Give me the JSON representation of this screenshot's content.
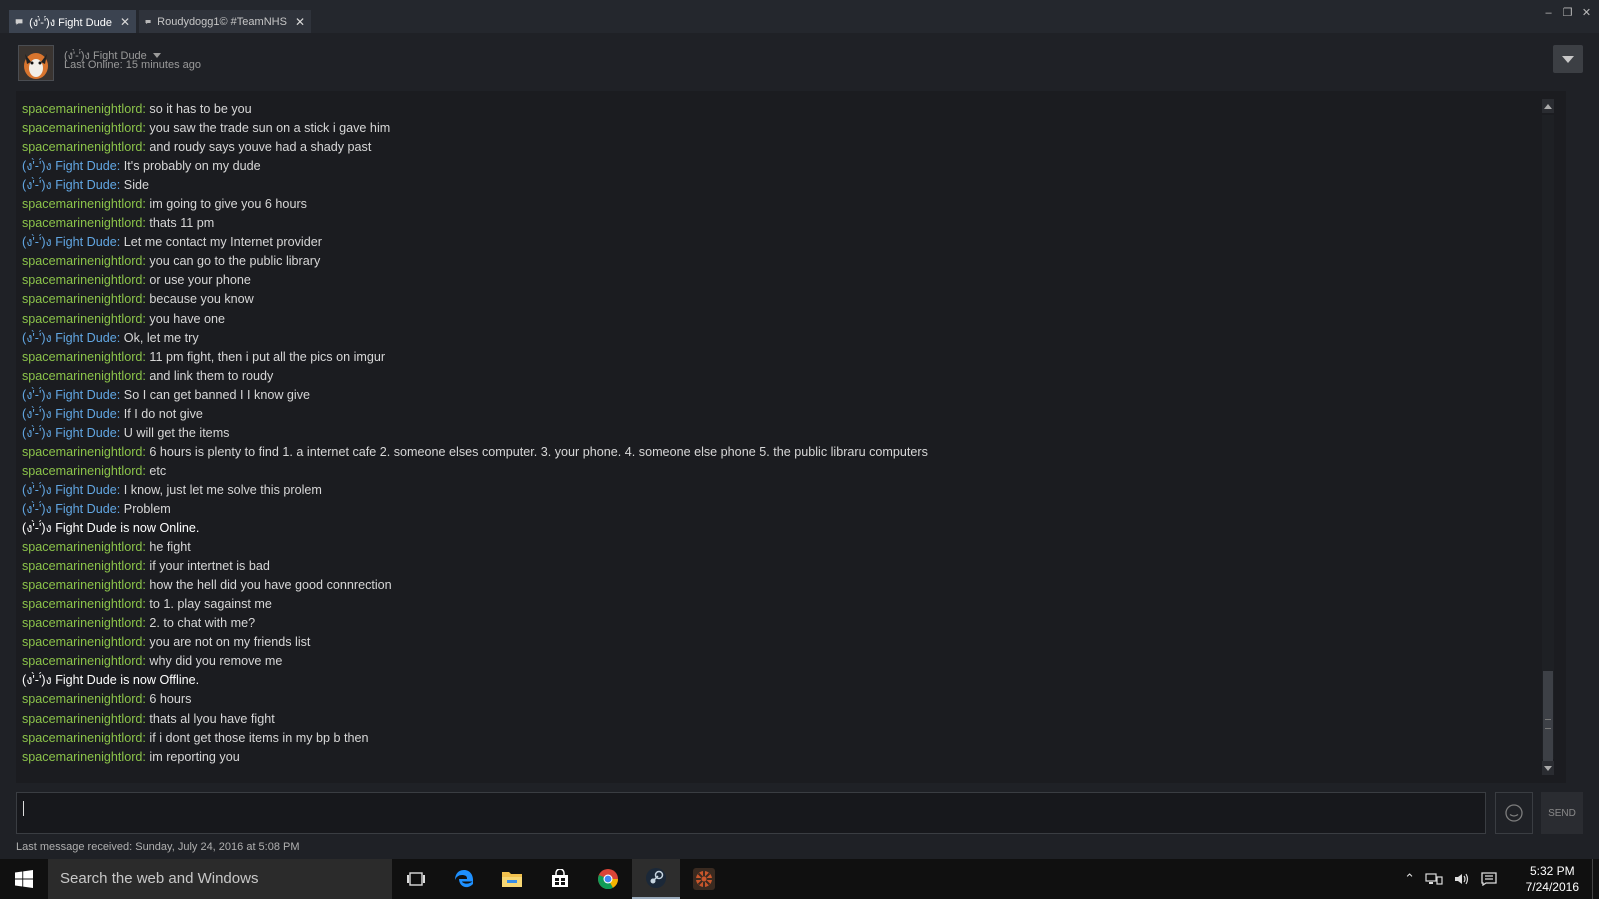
{
  "tabs": [
    {
      "label": "(ง'̀-'́)ง Fight Dude",
      "active": true
    },
    {
      "label": "Roudydogg1© #TeamNHS",
      "active": false
    }
  ],
  "window_controls": {
    "minimize": "–",
    "restore": "❐",
    "close": "✕"
  },
  "header": {
    "friend_name": "(ง'̀-'́)ง Fight Dude",
    "status": "Last Online: 15 minutes ago"
  },
  "colors": {
    "self_name": "#8bc34a",
    "friend_name": "#62a7e3",
    "message_text": "#d7d7d7",
    "background": "#1f2126"
  },
  "messages": [
    {
      "kind": "chat",
      "sender": "spacemarinenightlord",
      "side": "self",
      "text": "so it has to be you"
    },
    {
      "kind": "chat",
      "sender": "spacemarinenightlord",
      "side": "self",
      "text": "you saw the trade sun on a stick i gave him"
    },
    {
      "kind": "chat",
      "sender": "spacemarinenightlord",
      "side": "self",
      "text": "and roudy says youve had a shady past"
    },
    {
      "kind": "chat",
      "sender": "(ง'̀-'́)ง Fight Dude",
      "side": "friend",
      "text": "It's probably on my dude"
    },
    {
      "kind": "chat",
      "sender": "(ง'̀-'́)ง Fight Dude",
      "side": "friend",
      "text": "Side"
    },
    {
      "kind": "chat",
      "sender": "spacemarinenightlord",
      "side": "self",
      "text": "im going to give you 6 hours"
    },
    {
      "kind": "chat",
      "sender": "spacemarinenightlord",
      "side": "self",
      "text": "thats 11 pm"
    },
    {
      "kind": "chat",
      "sender": "(ง'̀-'́)ง Fight Dude",
      "side": "friend",
      "text": "Let me contact my Internet provider"
    },
    {
      "kind": "chat",
      "sender": "spacemarinenightlord",
      "side": "self",
      "text": "you can go to the public library"
    },
    {
      "kind": "chat",
      "sender": "spacemarinenightlord",
      "side": "self",
      "text": "or use your phone"
    },
    {
      "kind": "chat",
      "sender": "spacemarinenightlord",
      "side": "self",
      "text": "because you know"
    },
    {
      "kind": "chat",
      "sender": "spacemarinenightlord",
      "side": "self",
      "text": "you have one"
    },
    {
      "kind": "chat",
      "sender": "(ง'̀-'́)ง Fight Dude",
      "side": "friend",
      "text": "Ok, let me try"
    },
    {
      "kind": "chat",
      "sender": "spacemarinenightlord",
      "side": "self",
      "text": "11 pm fight, then i put all the pics on imgur"
    },
    {
      "kind": "chat",
      "sender": "spacemarinenightlord",
      "side": "self",
      "text": "and link them to roudy"
    },
    {
      "kind": "chat",
      "sender": "(ง'̀-'́)ง Fight Dude",
      "side": "friend",
      "text": "So I can get banned I I know give"
    },
    {
      "kind": "chat",
      "sender": "(ง'̀-'́)ง Fight Dude",
      "side": "friend",
      "text": "If I do not give"
    },
    {
      "kind": "chat",
      "sender": "(ง'̀-'́)ง Fight Dude",
      "side": "friend",
      "text": "U will get the items"
    },
    {
      "kind": "chat",
      "sender": "spacemarinenightlord",
      "side": "self",
      "text": "6 hours is plenty to find 1. a internet cafe 2. someone elses computer. 3. your phone. 4. someone else phone 5. the public libraru computers"
    },
    {
      "kind": "chat",
      "sender": "spacemarinenightlord",
      "side": "self",
      "text": "etc"
    },
    {
      "kind": "chat",
      "sender": "(ง'̀-'́)ง Fight Dude",
      "side": "friend",
      "text": "I know, just let me solve this prolem"
    },
    {
      "kind": "chat",
      "sender": "(ง'̀-'́)ง Fight Dude",
      "side": "friend",
      "text": "Problem"
    },
    {
      "kind": "status",
      "text": "(ง'̀-'́)ง Fight Dude is now Online."
    },
    {
      "kind": "chat",
      "sender": "spacemarinenightlord",
      "side": "self",
      "text": "he fight"
    },
    {
      "kind": "chat",
      "sender": "spacemarinenightlord",
      "side": "self",
      "text": "if your intertnet is bad"
    },
    {
      "kind": "chat",
      "sender": "spacemarinenightlord",
      "side": "self",
      "text": "how the hell did you have good connrection"
    },
    {
      "kind": "chat",
      "sender": "spacemarinenightlord",
      "side": "self",
      "text": "to 1. play sagainst me"
    },
    {
      "kind": "chat",
      "sender": "spacemarinenightlord",
      "side": "self",
      "text": "2. to chat with me?"
    },
    {
      "kind": "chat",
      "sender": "spacemarinenightlord",
      "side": "self",
      "text": "you are not on my friends list"
    },
    {
      "kind": "chat",
      "sender": "spacemarinenightlord",
      "side": "self",
      "text": "why did you remove me"
    },
    {
      "kind": "status",
      "text": "(ง'̀-'́)ง Fight Dude is now Offline."
    },
    {
      "kind": "chat",
      "sender": "spacemarinenightlord",
      "side": "self",
      "text": "6 hours"
    },
    {
      "kind": "chat",
      "sender": "spacemarinenightlord",
      "side": "self",
      "text": "thats al lyou have fight"
    },
    {
      "kind": "chat",
      "sender": "spacemarinenightlord",
      "side": "self",
      "text": "if i dont get those items in my bp b then"
    },
    {
      "kind": "chat",
      "sender": "spacemarinenightlord",
      "side": "self",
      "text": "im reporting you"
    }
  ],
  "input": {
    "value": "",
    "send_label": "SEND"
  },
  "footer": {
    "last_received": "Last message received: Sunday, July 24, 2016 at 5:08 PM"
  },
  "taskbar": {
    "search_placeholder": "Search the web and Windows",
    "time": "5:32 PM",
    "date": "7/24/2016",
    "apps": [
      "task-view-icon",
      "edge-icon",
      "file-explorer-icon",
      "store-icon",
      "chrome-icon",
      "steam-icon",
      "tf2-icon"
    ]
  }
}
